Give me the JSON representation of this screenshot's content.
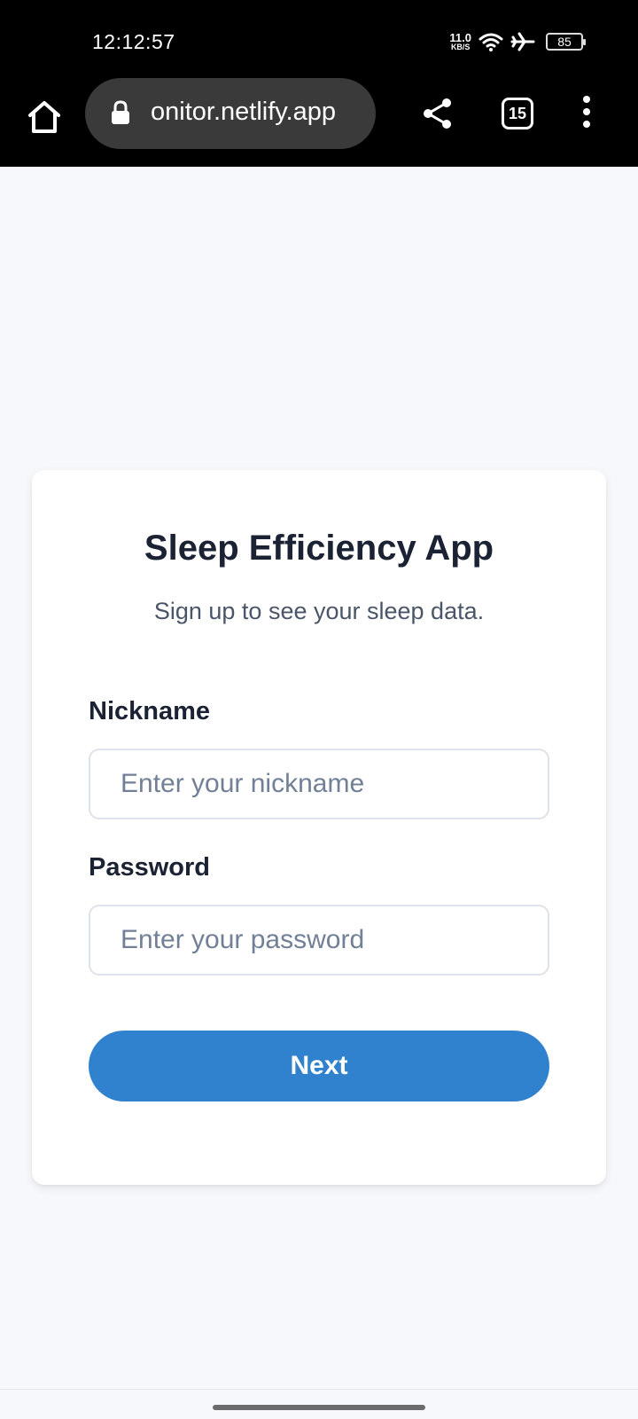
{
  "status_bar": {
    "time": "12:12:57",
    "net_speed_value": "11.0",
    "net_speed_unit": "KB/S",
    "battery_level": "85",
    "icons": [
      "wifi-icon",
      "airplane-icon",
      "battery-icon"
    ]
  },
  "browser": {
    "url": "onitor.netlify.app",
    "tab_count": "15",
    "icons": [
      "home-icon",
      "lock-icon",
      "share-icon",
      "tabs-icon",
      "more-icon"
    ]
  },
  "form": {
    "title": "Sleep Efficiency App",
    "subtitle": "Sign up to see your sleep data.",
    "nickname_label": "Nickname",
    "nickname_placeholder": "Enter your nickname",
    "nickname_value": "",
    "password_label": "Password",
    "password_placeholder": "Enter your password",
    "password_value": "",
    "submit_label": "Next"
  },
  "colors": {
    "page_background": "#f6f8fb",
    "primary_button": "#3182ce",
    "title_text": "#1a2233",
    "placeholder_text": "#718096"
  }
}
